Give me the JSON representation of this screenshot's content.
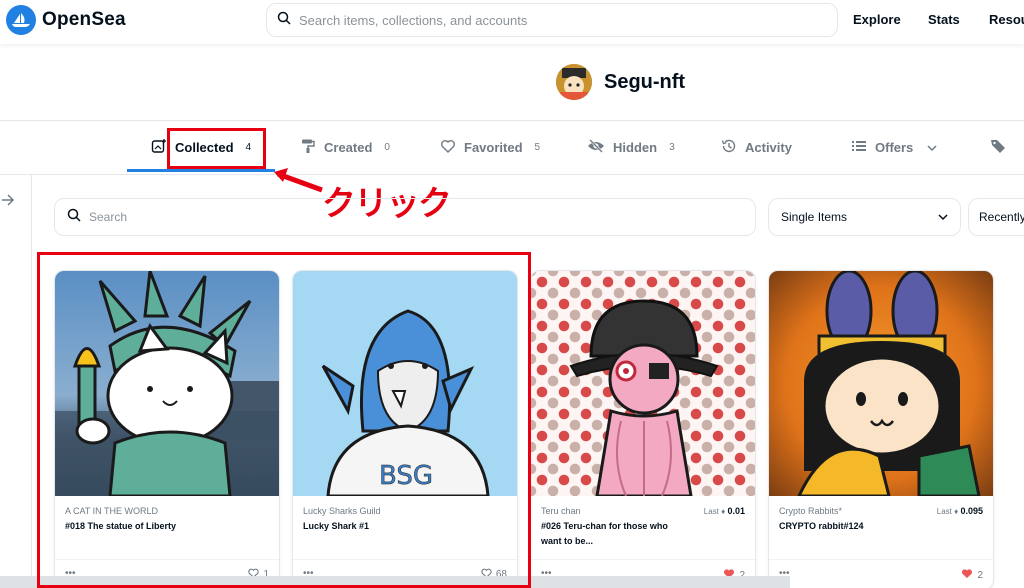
{
  "header": {
    "brand": "OpenSea",
    "search_placeholder": "Search items, collections, and accounts",
    "nav": [
      "Explore",
      "Stats",
      "Resou"
    ]
  },
  "profile": {
    "name": "Segu-nft"
  },
  "tabs": [
    {
      "label": "Collected",
      "count": "4"
    },
    {
      "label": "Created",
      "count": "0"
    },
    {
      "label": "Favorited",
      "count": "5"
    },
    {
      "label": "Hidden",
      "count": "3"
    },
    {
      "label": "Activity",
      "count": ""
    },
    {
      "label": "Offers",
      "count": ""
    }
  ],
  "annotation": {
    "text": "クリック",
    "color": "#e60012"
  },
  "filters": {
    "search_placeholder": "Search",
    "item_select": "Single Items",
    "sort_select": "Recently"
  },
  "cards": [
    {
      "collection": "A CAT IN THE WORLD",
      "title": "#018 The statue of Liberty",
      "last_label": "",
      "last_price": "",
      "likes": "1",
      "liked": false
    },
    {
      "collection": "Lucky Sharks Guild",
      "title": "Lucky Shark #1",
      "last_label": "",
      "last_price": "",
      "likes": "68",
      "liked": false
    },
    {
      "collection": "Teru chan",
      "title": "#026 Teru-chan for those who want to be...",
      "last_label": "Last",
      "last_price": "0.01",
      "likes": "2",
      "liked": true
    },
    {
      "collection": "Crypto Rabbits*",
      "title": "CRYPTO rabbit#124",
      "last_label": "Last",
      "last_price": "0.095",
      "likes": "2",
      "liked": true
    }
  ],
  "colors": {
    "accent": "#2081e2",
    "liked": "#eb5757"
  },
  "card_art_text": "BSG"
}
